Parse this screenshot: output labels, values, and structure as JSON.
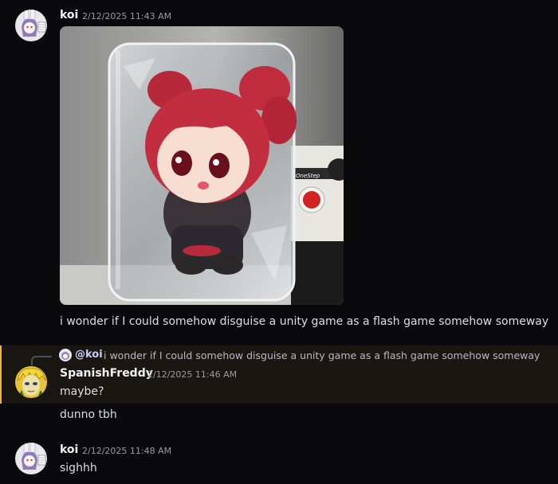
{
  "messages": [
    {
      "author": "koi",
      "timestamp": "2/12/2025 11:43 AM",
      "text": "i wonder if I could somehow disguise a unity game as a flash game somehow someway",
      "attachment": {
        "sticker_label": "OneStep"
      }
    },
    {
      "author": "SpanishFreddy",
      "timestamp": "2/12/2025 11:46 AM",
      "text": "maybe?",
      "reply_to": {
        "mention": "@koi",
        "preview": "i wonder if I could somehow disguise a unity game as a flash game somehow someway"
      }
    },
    {
      "text": "dunno tbh"
    },
    {
      "author": "koi",
      "timestamp": "2/12/2025 11:48 AM",
      "text": "sighhh"
    }
  ],
  "colors": {
    "background": "#0a0a0c",
    "reply_highlight": "#1a1713",
    "reply_bar": "#f0b232",
    "mention": "#c9cdfb"
  },
  "icons": {
    "koi_avatar": "anime-bunny-girl-avatar",
    "spanishfreddy_avatar": "blonde-anime-character-avatar"
  }
}
